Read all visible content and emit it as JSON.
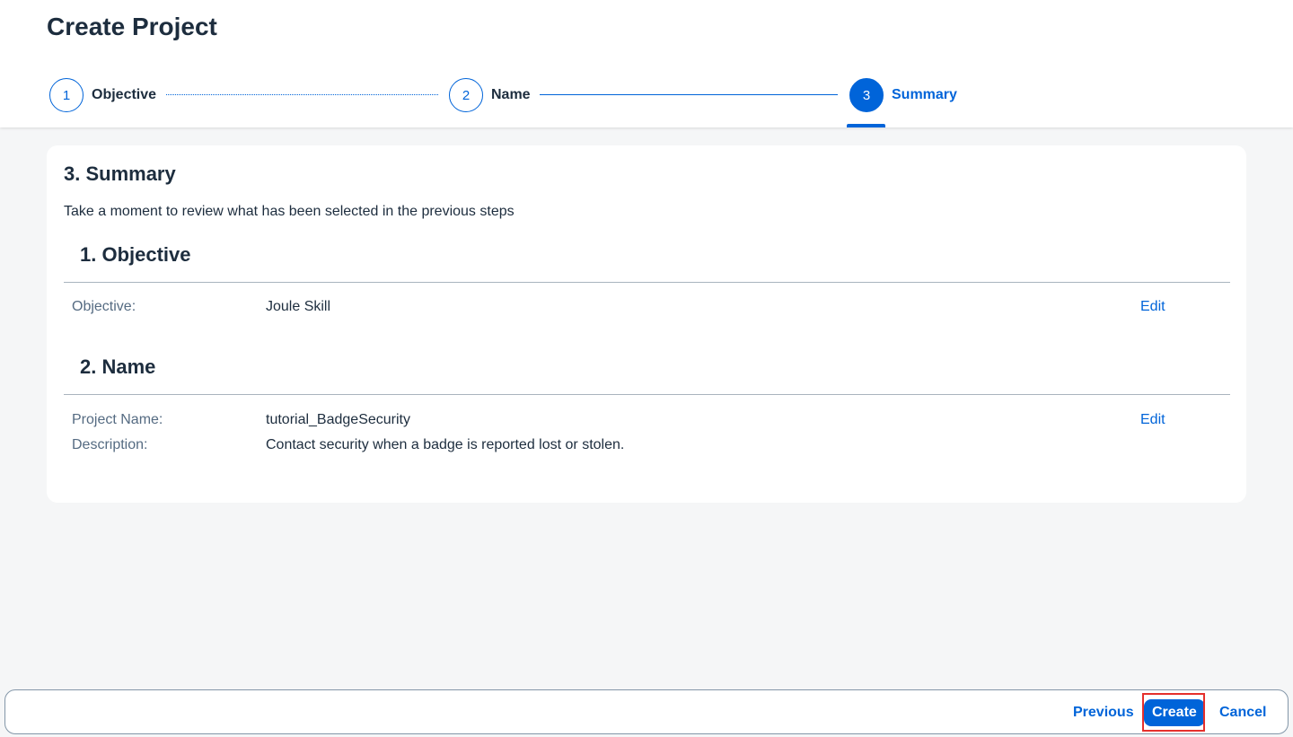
{
  "header": {
    "title": "Create Project",
    "steps": [
      {
        "number": "1",
        "label": "Objective",
        "state": "completed"
      },
      {
        "number": "2",
        "label": "Name",
        "state": "completed"
      },
      {
        "number": "3",
        "label": "Summary",
        "state": "active"
      }
    ]
  },
  "summary": {
    "title": "3. Summary",
    "description": "Take a moment to review what has been selected in the previous steps",
    "sections": [
      {
        "title": "1. Objective",
        "edit_label": "Edit",
        "rows": [
          {
            "label": "Objective:",
            "value": "Joule Skill"
          }
        ]
      },
      {
        "title": "2. Name",
        "edit_label": "Edit",
        "rows": [
          {
            "label": "Project Name:",
            "value": "tutorial_BadgeSecurity"
          },
          {
            "label": "Description:",
            "value": "Contact security when a badge is reported lost or stolen."
          }
        ]
      }
    ]
  },
  "footer": {
    "previous_label": "Previous",
    "create_label": "Create",
    "cancel_label": "Cancel"
  },
  "colors": {
    "accent": "#0064d9",
    "highlight": "#e5302c",
    "background": "#f5f6f7"
  }
}
